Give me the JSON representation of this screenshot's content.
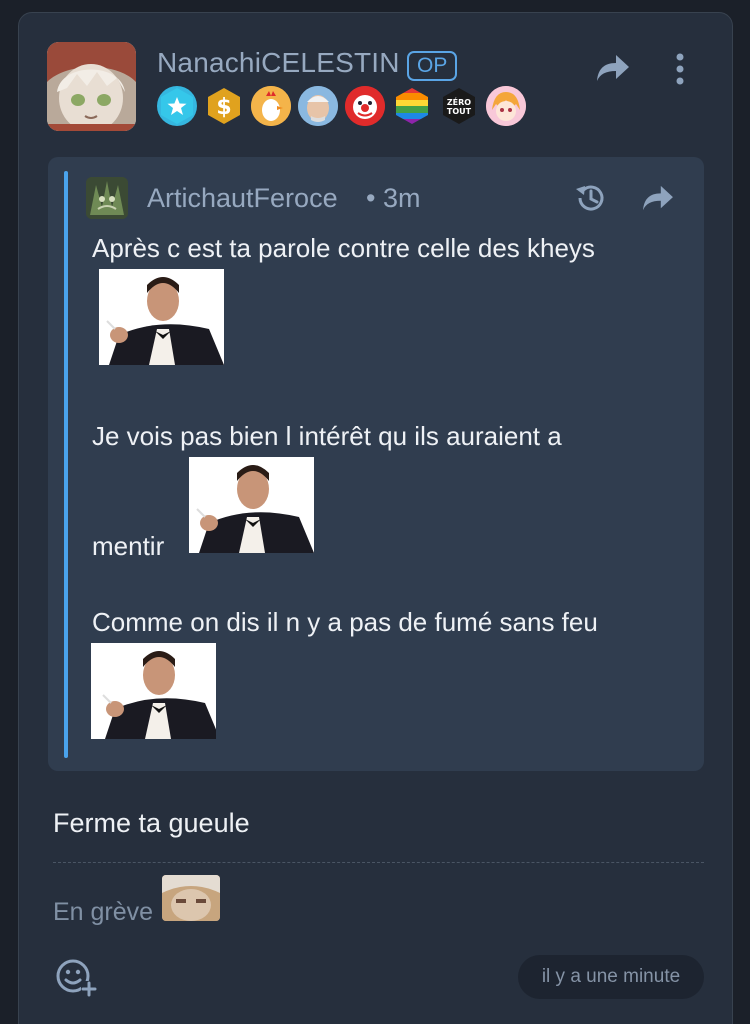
{
  "post": {
    "author": "NanachiCELESTIN",
    "op_label": "OP",
    "badges": [
      {
        "icon": "star-badge-icon",
        "color": "#35b7e0",
        "glyph": "★"
      },
      {
        "icon": "dollar-badge-icon",
        "color": "#e0a21e",
        "glyph": "$"
      },
      {
        "icon": "chicken-badge-icon",
        "color": "#f0882a",
        "glyph": ""
      },
      {
        "icon": "harold-badge-icon",
        "color": "#6aa7d8",
        "glyph": ""
      },
      {
        "icon": "clown-badge-icon",
        "color": "#e02b2b",
        "glyph": ""
      },
      {
        "icon": "rainbow-badge-icon",
        "color": "#e84c9a",
        "glyph": ""
      },
      {
        "icon": "zero-tout-badge-icon",
        "color": "#1a1a1a",
        "glyph": "ZÉRO TOUT"
      },
      {
        "icon": "anime-girl-badge-icon",
        "color": "#f2a7c0",
        "glyph": ""
      }
    ],
    "text": "Ferme ta gueule",
    "signature": "En grève",
    "timestamp": "il y a une minute"
  },
  "quote": {
    "author": "ArtichautFeroce",
    "time": "• 3m",
    "lines": {
      "line1": "Après c est ta parole contre celle des kheys",
      "line2": "Je vois pas bien l intérêt qu ils auraient a",
      "line3": "mentir",
      "line4": "Comme on dis il n y a pas de fumé sans feu"
    }
  },
  "colors": {
    "background": "#1b2029",
    "card": "#262f3d",
    "quote_bg": "#303d4f",
    "accent": "#4aa3ec",
    "username": "#97a9c0"
  }
}
